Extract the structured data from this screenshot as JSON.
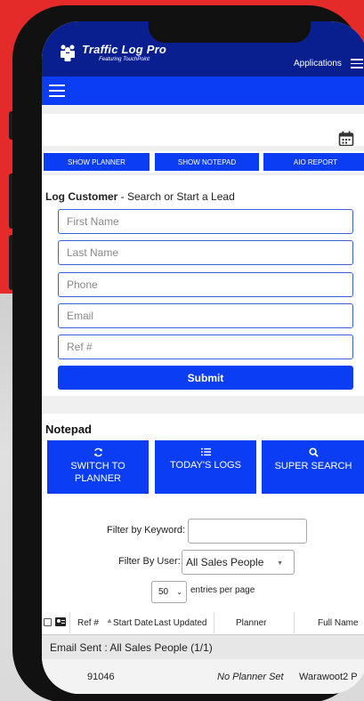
{
  "header": {
    "logo_title": "Traffic Log Pro",
    "logo_subtitle": "Featuring TouchPoint",
    "applications_label": "Applications"
  },
  "toolbar": {
    "show_planner": "SHOW PLANNER",
    "show_notepad": "SHOW NOTEPAD",
    "aio_report": "AIO REPORT"
  },
  "log_customer": {
    "title_bold": "Log Customer",
    "title_rest": " - Search or Start a Lead",
    "first_name_placeholder": "First Name",
    "last_name_placeholder": "Last Name",
    "phone_placeholder": "Phone",
    "email_placeholder": "Email",
    "ref_placeholder": "Ref #",
    "submit_label": "Submit"
  },
  "notepad": {
    "title": "Notepad",
    "switch_label_line1": "SWITCH TO",
    "switch_label_line2": "PLANNER",
    "todays_logs_label": "TODAY'S LOGS",
    "super_search_label": "SUPER SEARCH",
    "filter_keyword_label": "Filter by Keyword:",
    "filter_keyword_value": "",
    "filter_user_label": "Filter By User:",
    "filter_user_value": "All Sales People",
    "entries_value": "50",
    "entries_label": "entries per page"
  },
  "table": {
    "columns": [
      "Ref #",
      "Start Date",
      "Last Updated",
      "Planner",
      "Full Name"
    ],
    "group_label": "Email Sent : All Sales People (1/1)",
    "rows": [
      {
        "ref": "91046",
        "planner": "No Planner Set",
        "full_name": "Warawoot2 P"
      }
    ]
  },
  "colors": {
    "brand_dark": "#0a1f8f",
    "brand_blue": "#0b3df5",
    "background_red": "#e52a2a"
  }
}
